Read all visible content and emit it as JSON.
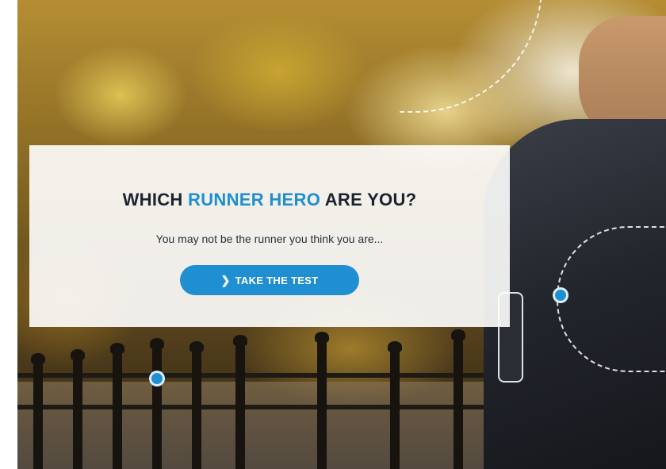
{
  "hero": {
    "heading_prefix": "WHICH ",
    "heading_accent": "RUNNER HERO",
    "heading_suffix": " ARE YOU?",
    "subtitle": "You may not be the runner you think you are...",
    "cta_label": "TAKE THE TEST",
    "cta_icon": "chevron-right-icon"
  },
  "colors": {
    "accent": "#1f8fd1",
    "heading": "#1c2230",
    "card_background": "rgba(255,255,255,0.90)"
  }
}
